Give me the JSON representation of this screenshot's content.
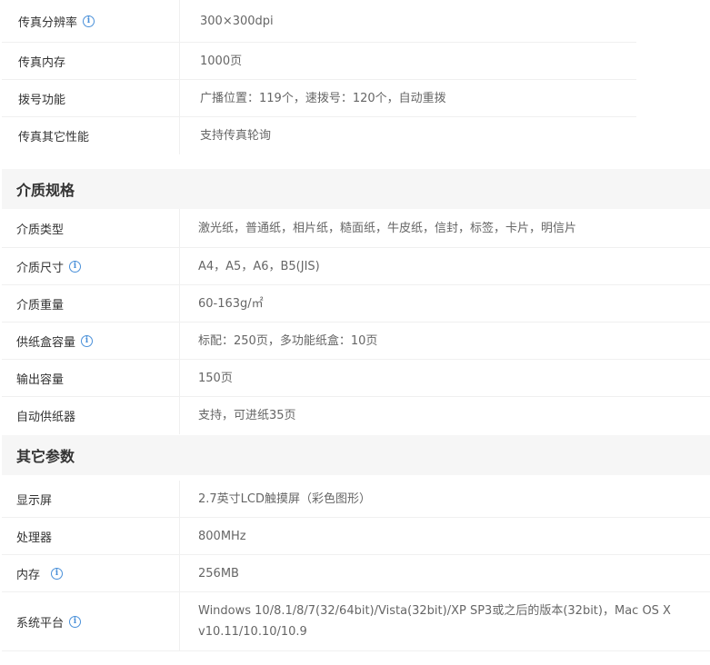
{
  "fax_rows": [
    {
      "label": "传真分辨率",
      "value": "300×300dpi",
      "info": true
    },
    {
      "label": "传真内存",
      "value": "1000页",
      "info": false
    },
    {
      "label": "拨号功能",
      "value": "广播位置：119个，速拨号：120个，自动重拨",
      "info": false
    },
    {
      "label": "传真其它性能",
      "value": "支持传真轮询",
      "info": false
    }
  ],
  "media_section": {
    "title": "介质规格",
    "rows": [
      {
        "label": "介质类型",
        "value": "激光纸，普通纸，相片纸，糙面纸，牛皮纸，信封，标签，卡片，明信片",
        "info": false
      },
      {
        "label": "介质尺寸",
        "value": "A4，A5，A6，B5(JIS)",
        "info": true
      },
      {
        "label": "介质重量",
        "value": "60-163g/㎡",
        "info": false
      },
      {
        "label": "供纸盒容量",
        "value": "标配：250页，多功能纸盒：10页",
        "info": true
      },
      {
        "label": "输出容量",
        "value": "150页",
        "info": false
      },
      {
        "label": "自动供纸器",
        "value": "支持，可进纸35页",
        "info": false
      }
    ]
  },
  "other_section": {
    "title": "其它参数",
    "rows": [
      {
        "label": "显示屏",
        "value": "2.7英寸LCD触摸屏（彩色图形）",
        "info": false
      },
      {
        "label": "处理器",
        "value": "800MHz",
        "info": false
      },
      {
        "label": "内存",
        "value": "256MB",
        "info": true
      },
      {
        "label": "系统平台",
        "value": "Windows 10/8.1/8/7(32/64bit)/Vista(32bit)/XP SP3或之后的版本(32bit)，Mac OS X v10.11/10.10/10.9",
        "info": true
      }
    ]
  },
  "icons": {
    "info": "info-icon"
  },
  "colors": {
    "info_icon": "#4a90d9",
    "section_bg": "#f6f6f6",
    "border": "#f0f0f0"
  }
}
